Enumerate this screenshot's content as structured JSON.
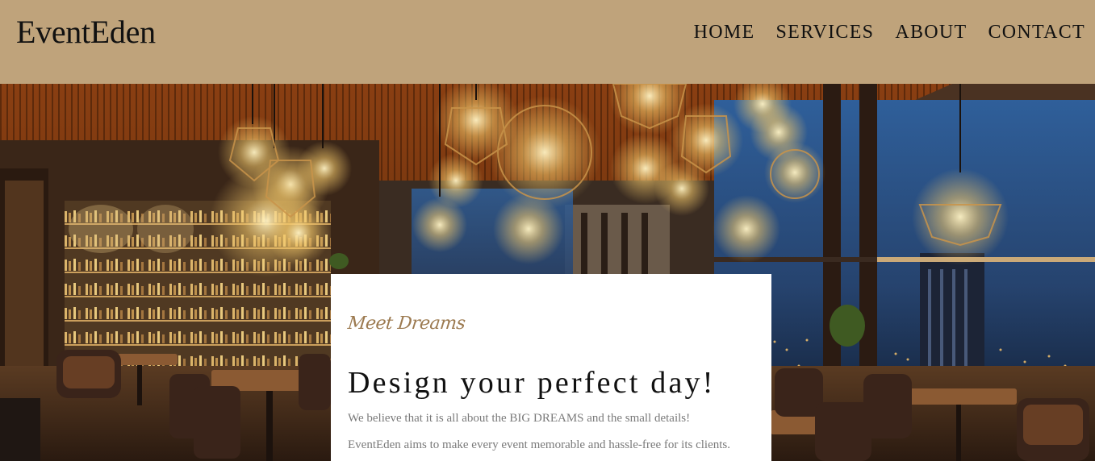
{
  "brand": {
    "name": "EventEden"
  },
  "nav": {
    "items": [
      {
        "label": "HOME"
      },
      {
        "label": "SERVICES"
      },
      {
        "label": "ABOUT"
      },
      {
        "label": "CONTACT"
      }
    ]
  },
  "hero": {
    "card": {
      "tagline": "Meet Dreams",
      "headline": "Design your perfect day!",
      "paragraphs": [
        "We believe that it is all about the BIG DREAMS and the small details!",
        "EventEden aims to make every event memorable and hassle-free for its clients."
      ]
    }
  },
  "colors": {
    "header_bg": "#bfa37b",
    "accent": "#9c7a50",
    "text_dark": "#111111",
    "text_muted": "#7a7a7a"
  }
}
